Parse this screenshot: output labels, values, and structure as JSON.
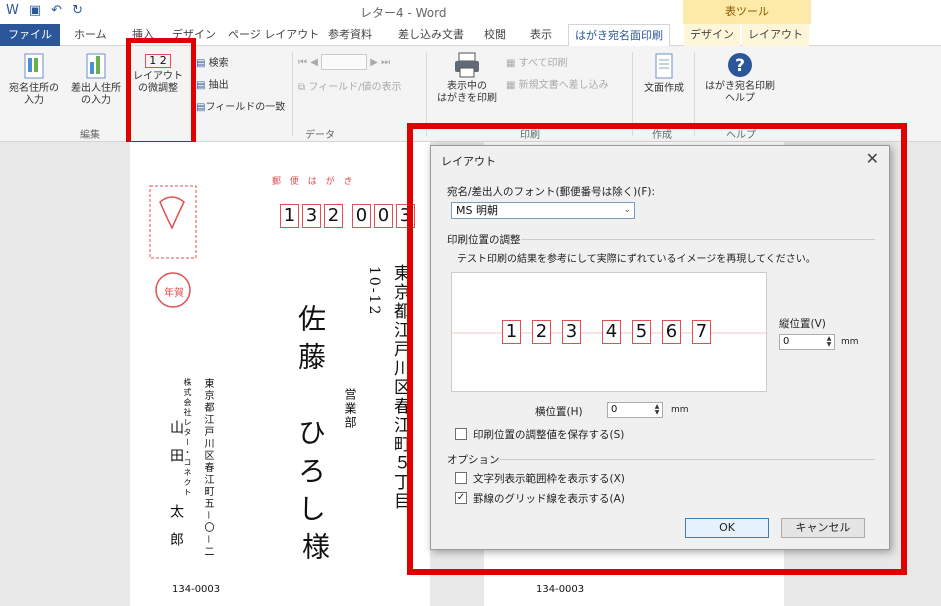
{
  "window": {
    "title": "レター4 - Word",
    "context_tab_group": "表ツール"
  },
  "tabs": [
    {
      "label": "ファイル"
    },
    {
      "label": "ホーム"
    },
    {
      "label": "挿入"
    },
    {
      "label": "デザイン"
    },
    {
      "label": "ページ レイアウト"
    },
    {
      "label": "参考資料"
    },
    {
      "label": "差し込み文書"
    },
    {
      "label": "校閲"
    },
    {
      "label": "表示"
    },
    {
      "label": "はがき宛名面印刷"
    },
    {
      "label": "デザイン"
    },
    {
      "label": "レイアウト"
    }
  ],
  "ribbon": {
    "addressee_input": "宛名住所の\n入力",
    "sender_input": "差出人住所\nの入力",
    "layout_adjust": "レイアウト\nの微調整",
    "layout_icon_text": "1 2",
    "search": "検索",
    "extract": "抽出",
    "field_match": "フィールドの一致",
    "field_display": "フィールド/値の表示",
    "print_displayed": "表示中の\nはがきを印刷",
    "print_all": "すべて印刷",
    "merge_new_doc": "新規文書へ差し込み",
    "create_text": "文面作成",
    "help": "はがき宛名印刷\nヘルプ",
    "groups": {
      "edit": "編集",
      "data": "データ",
      "print": "印刷",
      "create": "作成",
      "help": "ヘルプ"
    }
  },
  "document": {
    "postal_header": "郵 便 は が き",
    "postal_code_digits": [
      "1",
      "3",
      "2",
      "0",
      "0",
      "3"
    ],
    "address_vertical": "東京都江戸川区春江町５丁目",
    "address_number": "10-12",
    "recipient_name": "佐藤　ひろし",
    "honorific": "様",
    "department": "営業部",
    "left_card_name": "山田　太郎",
    "left_card_address": "東京都江戸川区春江町五－〇－二",
    "left_card_company": "株式会社レター・コネクト",
    "postal_small_1": "134-0003",
    "postal_small_2": "134-0003",
    "stamp_text": "年賀"
  },
  "dialog": {
    "title": "レイアウト",
    "font_label": "宛名/差出人のフォント(郵便番号は除く)(F):",
    "font_value": "MS 明朝",
    "position_section": "印刷位置の調整",
    "position_desc": "テスト印刷の結果を参考にして実際にずれているイメージを再現してください。",
    "preview_digits": [
      "1",
      "2",
      "3",
      "4",
      "5",
      "6",
      "7"
    ],
    "vertical_label": "縦位置(V)",
    "vertical_value": "0",
    "vertical_unit": "mm",
    "horizontal_label": "横位置(H)",
    "horizontal_value": "0",
    "horizontal_unit": "mm",
    "save_position_label": "印刷位置の調整値を保存する(S)",
    "save_position_checked": false,
    "options_section": "オプション",
    "show_text_frame_label": "文字列表示範囲枠を表示する(X)",
    "show_text_frame_checked": false,
    "show_grid_label": "罫線のグリッド線を表示する(A)",
    "show_grid_checked": true,
    "ok_label": "OK",
    "cancel_label": "キャンセル"
  },
  "colors": {
    "accent": "#2b579a",
    "highlight": "#e00000",
    "context": "#fde9a8"
  }
}
